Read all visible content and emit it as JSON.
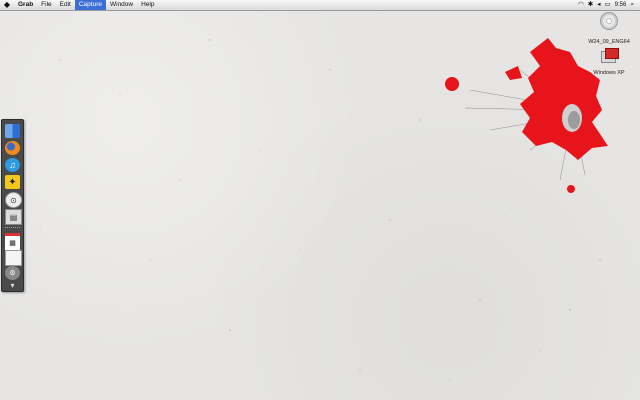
{
  "menubar": {
    "apple": "",
    "app_name": "Grab",
    "items": [
      "File",
      "Edit",
      "Capture",
      "Window",
      "Help"
    ],
    "active_item": "Capture",
    "clock": "9:56"
  },
  "desktop": {
    "icons": [
      {
        "label": "W24_09_ENG64",
        "icon": "disc-icon"
      },
      {
        "label": "Windows XP",
        "icon": "vm-icon"
      }
    ]
  },
  "dock": {
    "items": [
      "finder",
      "firefox",
      "itunes",
      "bird",
      "shield",
      "preview",
      "calendar",
      "textedit",
      "misc",
      "trash"
    ]
  },
  "colors": {
    "accent": "#3b6fd8",
    "splash": "#e8141c",
    "wall": "#e6e5e3"
  }
}
